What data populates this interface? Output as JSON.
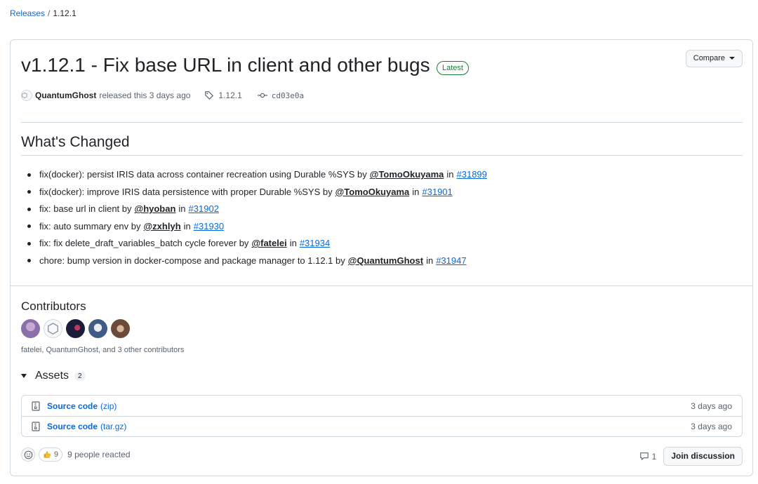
{
  "breadcrumb": {
    "parent": "Releases",
    "separator": "/",
    "current": "1.12.1"
  },
  "release": {
    "title": "v1.12.1 - Fix base URL in client and other bugs",
    "badge": "Latest",
    "compare_label": "Compare",
    "author": "QuantumGhost",
    "released_text": "released this 3 days ago",
    "tag": "1.12.1",
    "commit": "cd03e0a"
  },
  "changes": {
    "heading": "What's Changed",
    "items": [
      {
        "text": "fix(docker): persist IRIS data across container recreation using Durable %SYS by",
        "user": "@TomoOkuyama",
        "in": "in",
        "pr": "#31899"
      },
      {
        "text": "fix(docker): improve IRIS data persistence with proper Durable %SYS by",
        "user": "@TomoOkuyama",
        "in": "in",
        "pr": "#31901"
      },
      {
        "text": "fix: base url in client by",
        "user": "@hyoban",
        "in": "in",
        "pr": "#31902"
      },
      {
        "text": "fix: auto summary env by",
        "user": "@zxhlyh",
        "in": "in",
        "pr": "#31930"
      },
      {
        "text": "fix: fix delete_draft_variables_batch cycle forever by",
        "user": "@fatelei",
        "in": "in",
        "pr": "#31934"
      },
      {
        "text": "chore: bump version in docker-compose and package manager to 1.12.1 by",
        "user": "@QuantumGhost",
        "in": "in",
        "pr": "#31947"
      }
    ]
  },
  "contributors": {
    "heading": "Contributors",
    "summary": "fatelei, QuantumGhost, and 3 other contributors",
    "avatar_colors": [
      "#8a6fa8",
      "#f6f8fa",
      "#1b1b3a",
      "#3e5c86",
      "#6b4a3a"
    ]
  },
  "assets": {
    "heading": "Assets",
    "count": "2",
    "items": [
      {
        "name": "Source code",
        "ext": "(zip)",
        "date": "3 days ago",
        "icon": "file-zip-icon"
      },
      {
        "name": "Source code",
        "ext": "(tar.gz)",
        "date": "3 days ago",
        "icon": "file-zip-icon"
      }
    ]
  },
  "reactions": {
    "thumbs_count": "9",
    "summary": "9 people reacted"
  },
  "discussion": {
    "comment_count": "1",
    "join_label": "Join discussion"
  },
  "colors": {
    "link": "#0969da",
    "latest": "#1a7f37",
    "border": "#d1d9e0",
    "muted": "#59636e"
  }
}
